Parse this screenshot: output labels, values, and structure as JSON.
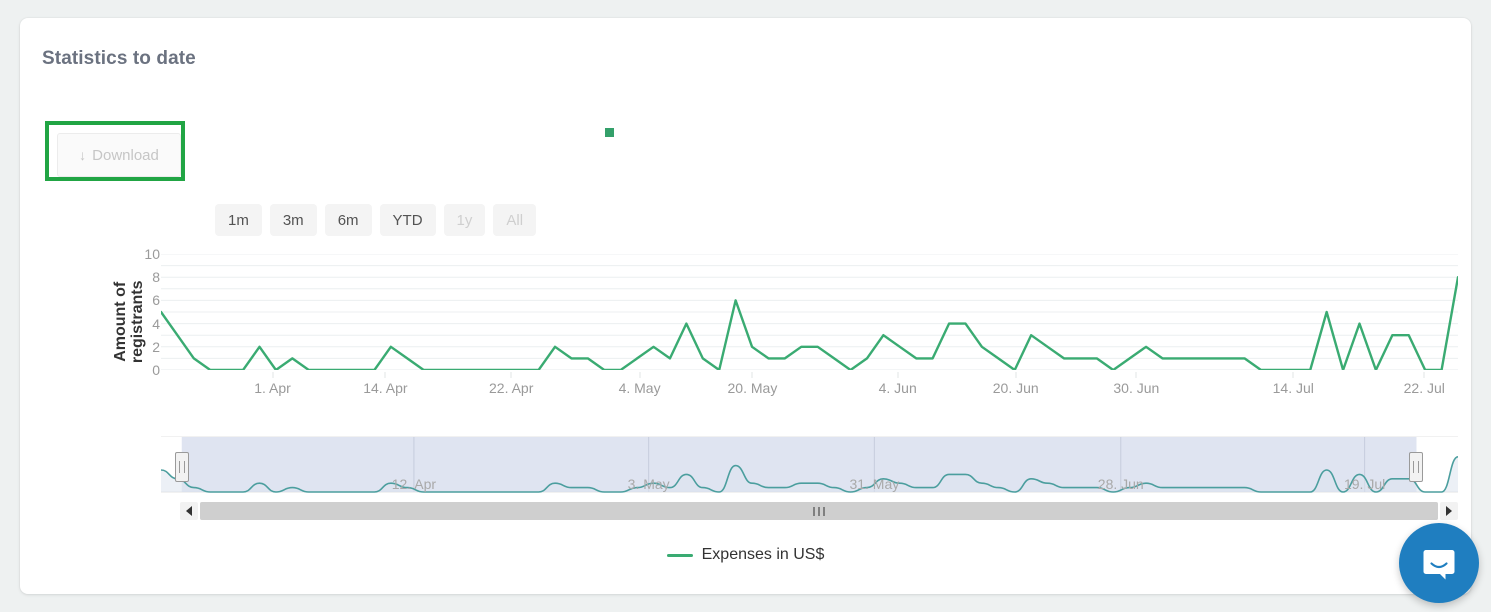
{
  "card": {
    "title": "Statistics to date"
  },
  "download": {
    "label": "Download",
    "icon": "download-arrow-icon",
    "glyph": "↓",
    "highlight_color": "#21a544"
  },
  "marker": {
    "color": "#34a06a"
  },
  "range_selector": {
    "buttons": [
      {
        "label": "1m",
        "dim": false
      },
      {
        "label": "3m",
        "dim": false
      },
      {
        "label": "6m",
        "dim": false
      },
      {
        "label": "YTD",
        "dim": false
      },
      {
        "label": "1y",
        "dim": true
      },
      {
        "label": "All",
        "dim": true
      }
    ]
  },
  "legend": {
    "items": [
      {
        "label": "Expenses in US$",
        "color": "#3aab72"
      }
    ]
  },
  "scrollbar": {
    "left_arrow": "◀",
    "right_arrow": "▶"
  },
  "chat": {
    "icon": "chat-bubble-icon",
    "color": "#1f7ec0"
  },
  "chart_data": {
    "type": "line",
    "title": "Statistics to date",
    "xlabel": "",
    "ylabel": "Amount of\nregistrants",
    "ylim": [
      0,
      10
    ],
    "yticks": [
      0,
      2,
      4,
      6,
      8,
      10
    ],
    "grid": true,
    "legend_position": "bottom",
    "series": [
      {
        "name": "Expenses in US$",
        "color": "#3aab72",
        "values": [
          5,
          3,
          1,
          0,
          0,
          0,
          2,
          0,
          1,
          0,
          0,
          0,
          0,
          0,
          2,
          1,
          0,
          0,
          0,
          0,
          0,
          0,
          0,
          0,
          2,
          1,
          1,
          0,
          0,
          1,
          2,
          1,
          4,
          1,
          0,
          6,
          2,
          1,
          1,
          2,
          2,
          1,
          0,
          1,
          3,
          2,
          1,
          1,
          4,
          4,
          2,
          1,
          0,
          3,
          2,
          1,
          1,
          1,
          0,
          1,
          2,
          1,
          1,
          1,
          1,
          1,
          1,
          0,
          0,
          0,
          0,
          5,
          0,
          4,
          0,
          3,
          3,
          0,
          0,
          8
        ]
      }
    ],
    "xtick_labels": [
      "1. Apr",
      "14. Apr",
      "22. Apr",
      "4. May",
      "20. May",
      "4. Jun",
      "20. Jun",
      "30. Jun",
      "14. Jul",
      "22. Jul"
    ],
    "xtick_positions": [
      8.6,
      17.3,
      27.0,
      36.9,
      45.6,
      56.8,
      65.9,
      75.2,
      87.3,
      97.4
    ],
    "navigator": {
      "xtick_labels": [
        "12. Apr",
        "3. May",
        "31. May",
        "28. Jun",
        "19. Jul"
      ],
      "xtick_positions": [
        19.5,
        37.6,
        55.0,
        74.0,
        92.8
      ],
      "selection": {
        "from_pct": 1.6,
        "to_pct": 96.8
      },
      "line_color": "#4b9e9e",
      "mask_color": "#ccd4e8"
    }
  }
}
